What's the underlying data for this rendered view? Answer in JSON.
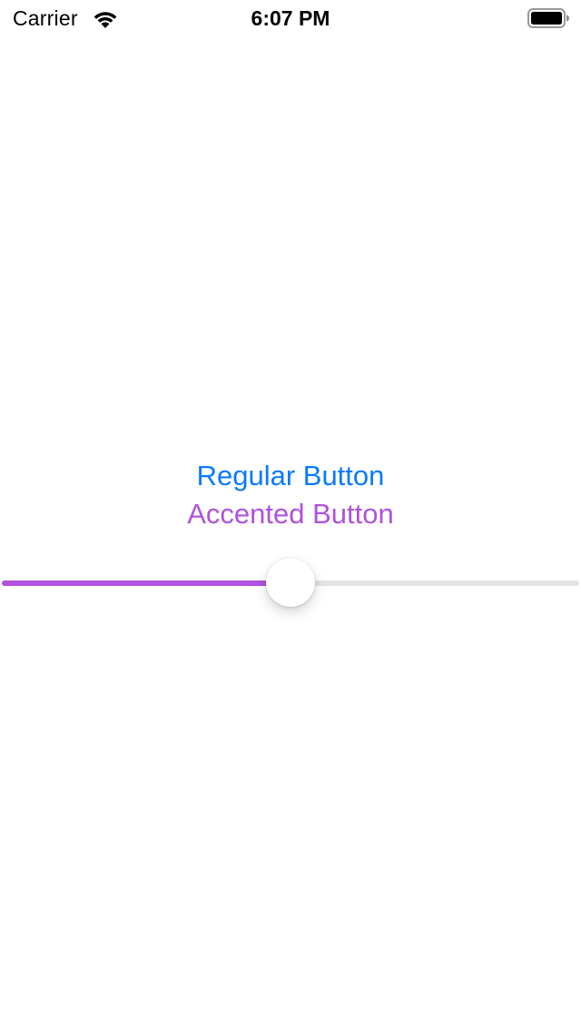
{
  "status_bar": {
    "carrier": "Carrier",
    "time": "6:07 PM",
    "wifi_icon": "wifi-icon",
    "battery_icon": "battery-icon"
  },
  "buttons": {
    "regular_label": "Regular Button",
    "accented_label": "Accented Button"
  },
  "slider": {
    "value": 0.5,
    "fill_color": "#af52de",
    "track_color": "#e3e3e6"
  },
  "colors": {
    "regular": "#0a7aff",
    "accent": "#af52de",
    "background": "#ffffff"
  }
}
